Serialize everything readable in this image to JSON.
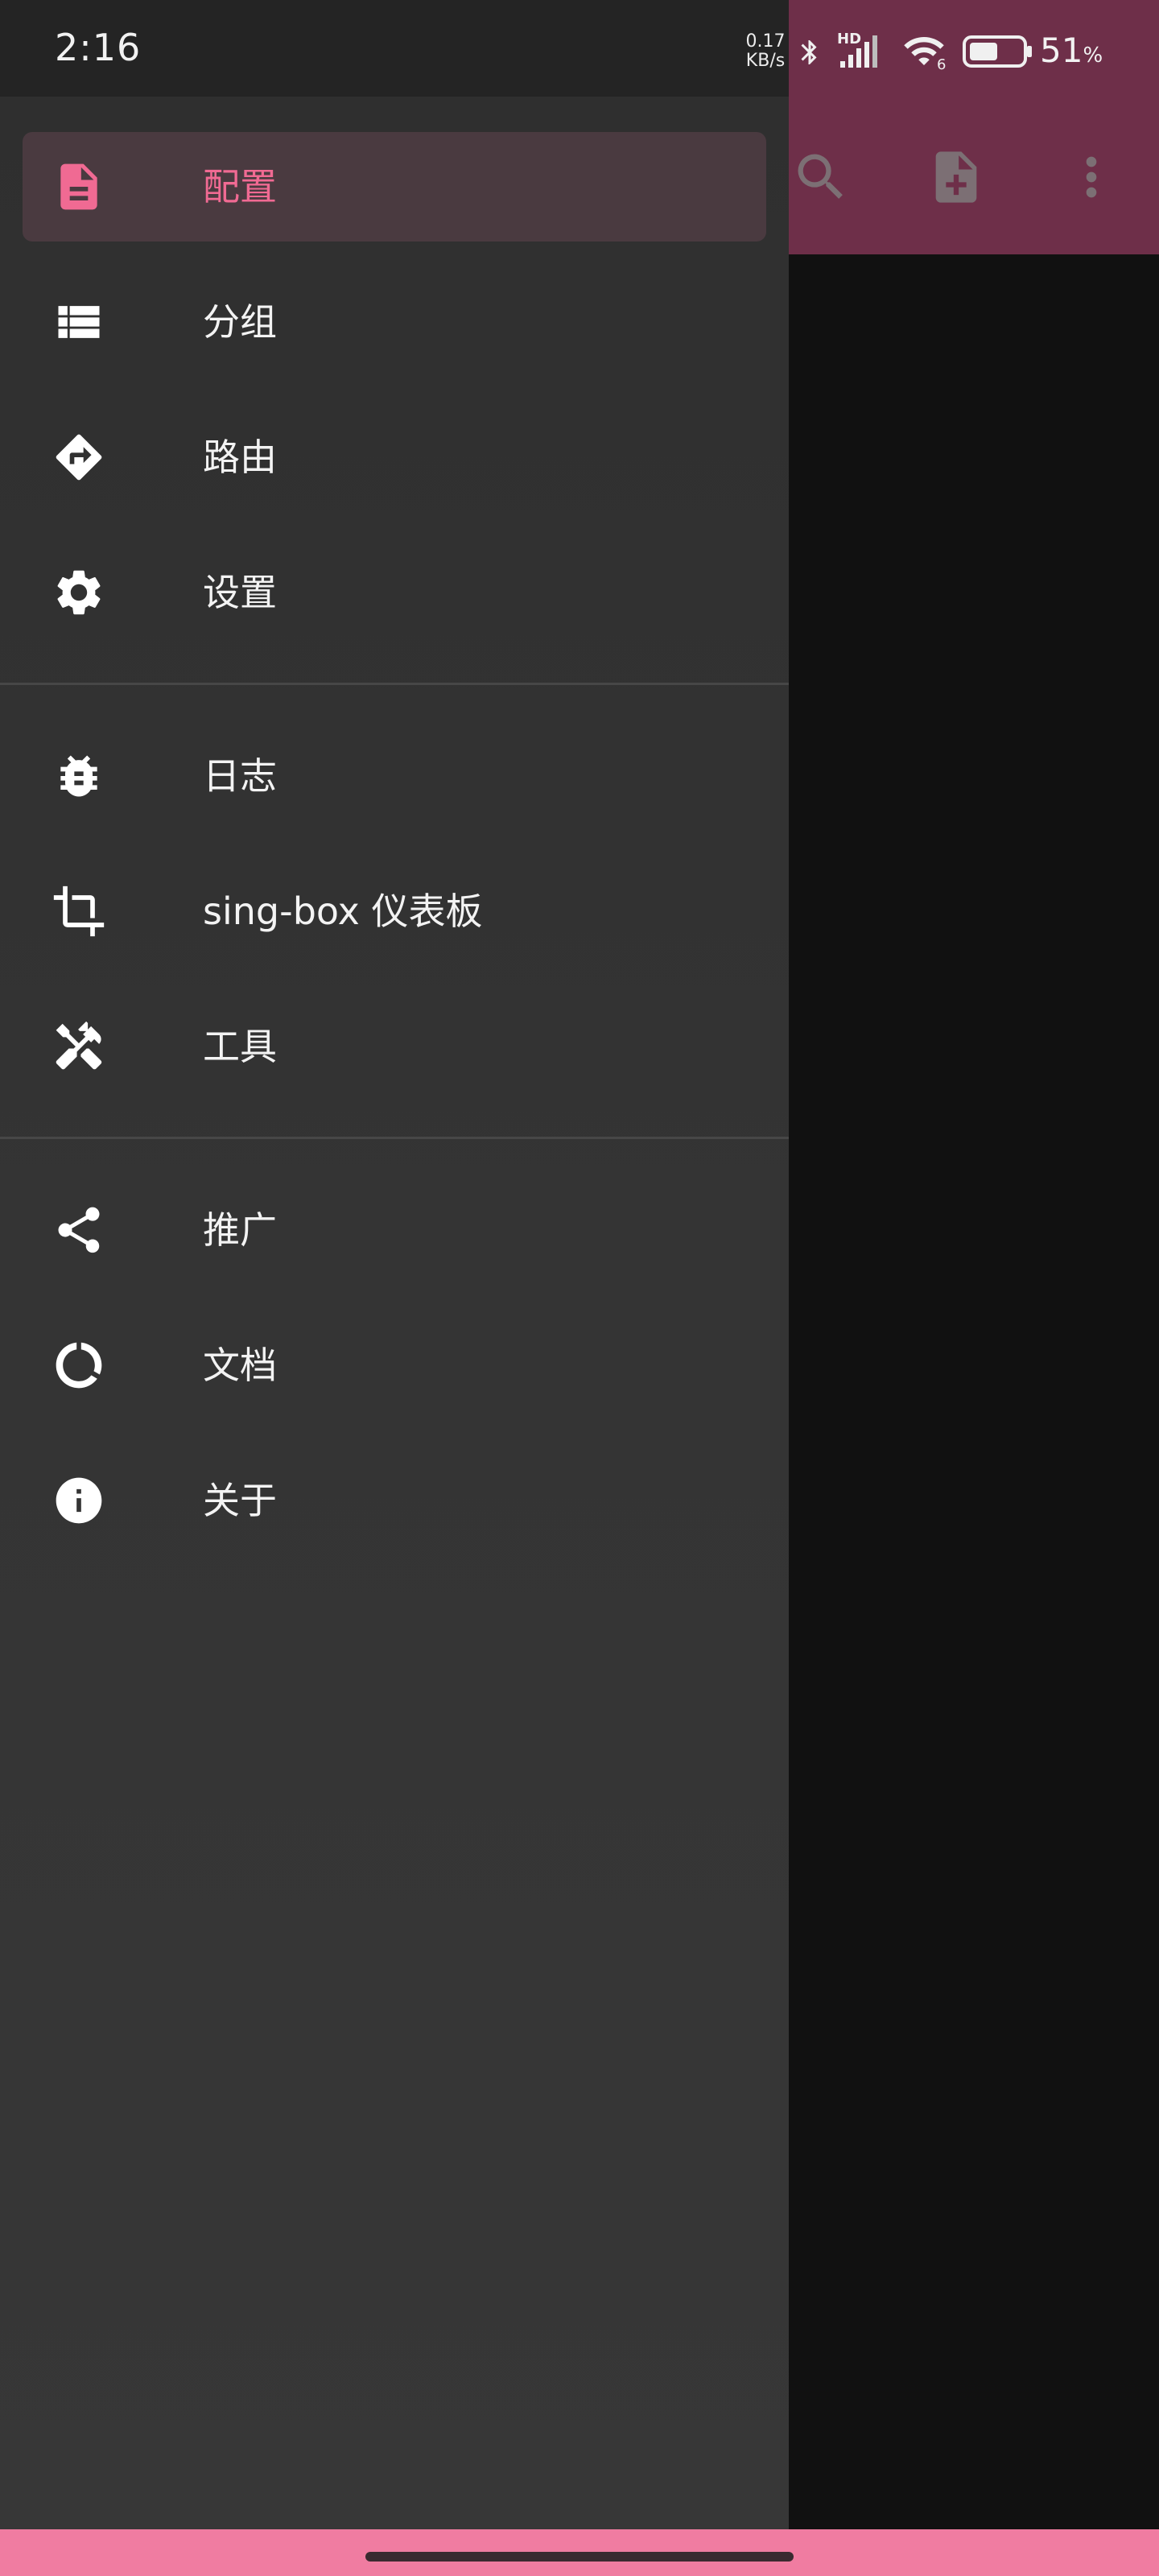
{
  "status_bar": {
    "time": "2:16",
    "net_speed_value": "0.17",
    "net_speed_unit": "KB/s",
    "signal_label": "HD",
    "wifi_label": "6",
    "battery_percent": "51",
    "battery_percent_sign": "%",
    "battery_level": 0.51
  },
  "toolbar": {
    "actions": [
      "search-icon",
      "add-file-icon",
      "more-vert-icon"
    ],
    "color": "#6e2f49"
  },
  "drawer": {
    "accent_color": "#f06a93",
    "groups": [
      {
        "items": [
          {
            "label": "配置",
            "icon": "description-icon",
            "active": true
          },
          {
            "label": "分组",
            "icon": "list-icon",
            "active": false
          },
          {
            "label": "路由",
            "icon": "directions-icon",
            "active": false
          },
          {
            "label": "设置",
            "icon": "settings-gear-icon",
            "active": false
          }
        ]
      },
      {
        "items": [
          {
            "label": "日志",
            "icon": "bug-icon",
            "active": false
          },
          {
            "label": "sing-box 仪表板",
            "icon": "crop-icon",
            "active": false
          },
          {
            "label": "工具",
            "icon": "tools-icon",
            "active": false
          }
        ]
      },
      {
        "items": [
          {
            "label": "推广",
            "icon": "share-icon",
            "active": false
          },
          {
            "label": "文档",
            "icon": "docs-ring-icon",
            "active": false
          },
          {
            "label": "关于",
            "icon": "info-icon",
            "active": false
          }
        ]
      }
    ]
  }
}
